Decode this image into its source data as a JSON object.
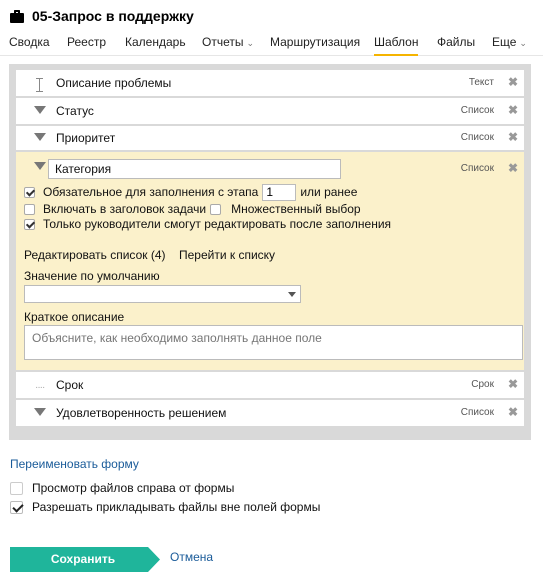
{
  "header": {
    "title": "05-Запрос в поддержку",
    "icon": "briefcase-icon"
  },
  "tabs": [
    {
      "label": "Сводка"
    },
    {
      "label": "Реестр"
    },
    {
      "label": "Календарь"
    },
    {
      "label": "Отчеты",
      "dropdown": true
    },
    {
      "label": "Маршрутизация"
    },
    {
      "label": "Шаблон",
      "active": true
    },
    {
      "label": "Файлы"
    },
    {
      "label": "Еще",
      "dropdown": true
    }
  ],
  "fields": [
    {
      "label": "Описание проблемы",
      "type": "Текст",
      "icon": "text-cursor-icon"
    },
    {
      "label": "Статус",
      "type": "Список",
      "icon": "triangle-down-icon"
    },
    {
      "label": "Приоритет",
      "type": "Список",
      "icon": "triangle-down-icon"
    },
    {
      "label": "Срок",
      "type": "Срок",
      "icon": "dots-icon"
    },
    {
      "label": "Удовлетворенность решением",
      "type": "Список",
      "icon": "triangle-down-icon"
    }
  ],
  "expanded_field": {
    "name": "Категория",
    "type": "Список",
    "required_prefix": "Обязательное для заполнения с этапа",
    "required_stage": "1",
    "required_suffix": "или ранее",
    "include_in_title": "Включать в заголовок задачи",
    "multiple_choice": "Множественный выбор",
    "managers_only": "Только руководители смогут редактировать после заполнения",
    "edit_list": "Редактировать список (4)",
    "go_to_list": "Перейти к списку",
    "default_label": "Значение по умолчанию",
    "default_value": "",
    "desc_label": "Краткое описание",
    "desc_placeholder": "Объясните, как необходимо заполнять данное поле"
  },
  "checks": {
    "required": true,
    "include_in_title": false,
    "multiple_choice": false,
    "managers_only": true
  },
  "footer": {
    "rename_form": "Переименовать форму",
    "view_files_right": "Просмотр файлов справа от формы",
    "view_files_right_checked": false,
    "allow_attach": "Разрешать прикладывать файлы вне полей формы",
    "allow_attach_checked": true,
    "save": "Сохранить",
    "cancel": "Отмена"
  },
  "colors": {
    "accent": "#1fb59b",
    "active_tab_underline": "#f5b400",
    "expanded_bg": "#fbf1cb",
    "link": "#1a5b99"
  },
  "delete_glyph": "✖"
}
